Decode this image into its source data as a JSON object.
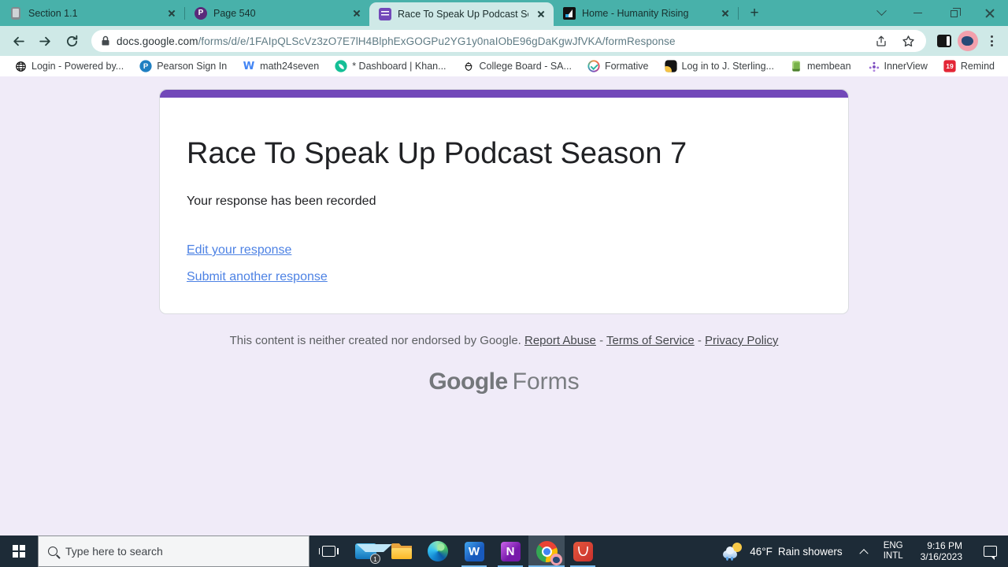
{
  "colors": {
    "tabstrip_teal": "#48b1aa",
    "toolbar_light": "#cfe9e7",
    "forms_purple": "#7248b9",
    "page_background": "#f0ebf8",
    "link_blue": "#4d82e4",
    "taskbar_dark": "#1d2b37"
  },
  "browser": {
    "tabs": [
      {
        "title": "Section 1.1"
      },
      {
        "title": "Page 540"
      },
      {
        "title": "Race To Speak Up Podcast Seaso"
      },
      {
        "title": "Home - Humanity Rising"
      }
    ],
    "new_tab_plus": "+",
    "url": {
      "domain": "docs.google.com",
      "path": "/forms/d/e/1FAIpQLScVz3zO7E7lH4BlphExGOGPu2YG1y0naIObE96gDaKgwJfVKA/formResponse"
    },
    "bookmarks": [
      {
        "label": "Login - Powered by..."
      },
      {
        "label": "Pearson Sign In"
      },
      {
        "label": "math24seven"
      },
      {
        "label": "* Dashboard | Khan..."
      },
      {
        "label": "College Board - SA..."
      },
      {
        "label": "Formative"
      },
      {
        "label": "Log in to J. Sterling..."
      },
      {
        "label": "membean"
      },
      {
        "label": "InnerView"
      },
      {
        "label": "Remind"
      }
    ],
    "overflow_chevron": "»",
    "icon_letters": {
      "pearson": "P",
      "math24seven": "W",
      "remind_badge": "19"
    }
  },
  "form": {
    "title": "Race To Speak Up Podcast Season 7",
    "status": "Your response has been recorded",
    "links": [
      {
        "label": "Edit your response"
      },
      {
        "label": "Submit another response"
      }
    ],
    "footer": {
      "text": "This content is neither created nor endorsed by Google.",
      "links": [
        "Report Abuse",
        "Terms of Service",
        "Privacy Policy"
      ],
      "separator": "-"
    },
    "logo": {
      "google": "Google",
      "forms": "Forms"
    }
  },
  "taskbar": {
    "search_placeholder": "Type here to search",
    "mail_badge": "1",
    "word_letter": "W",
    "onenote_letter": "N",
    "weather": {
      "temp": "46°F",
      "condition": "Rain showers"
    },
    "lang": {
      "line1": "ENG",
      "line2": "INTL"
    },
    "clock": {
      "time": "9:16 PM",
      "date": "3/16/2023"
    }
  }
}
